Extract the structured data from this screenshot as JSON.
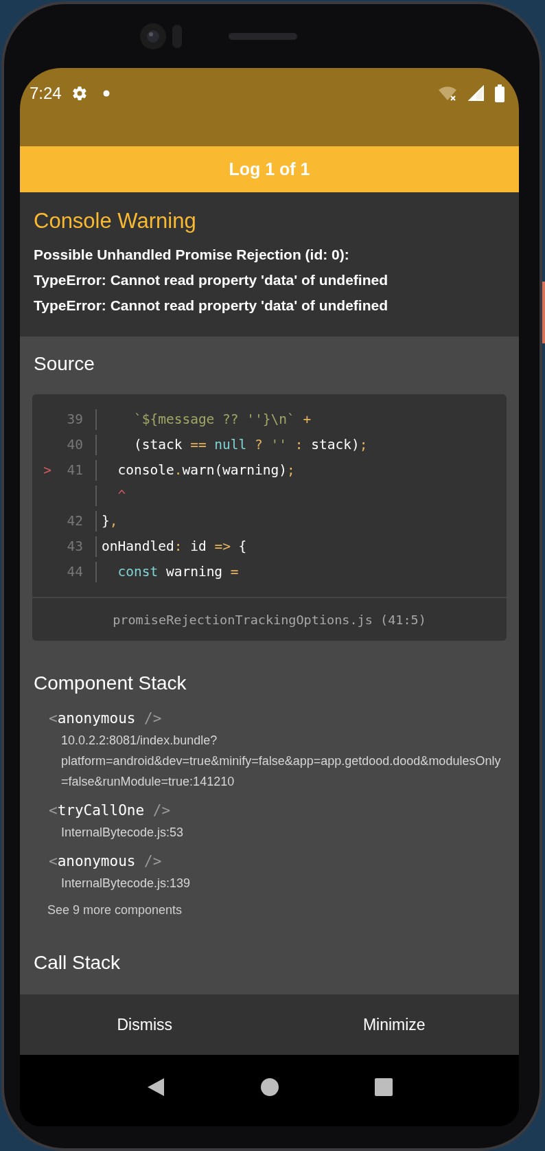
{
  "status_bar": {
    "time": "7:24"
  },
  "log_bar": {
    "title": "Log 1 of 1"
  },
  "header": {
    "title": "Console Warning",
    "message_lines": [
      "Possible Unhandled Promise Rejection (id: 0):",
      "TypeError: Cannot read property 'data' of undefined",
      "TypeError: Cannot read property 'data' of undefined"
    ]
  },
  "source": {
    "heading": "Source",
    "lines": [
      {
        "number": "39",
        "tokens": [
          {
            "text": "    `${message ?? ''}\\n`",
            "kind": "string"
          },
          {
            "text": " +",
            "kind": "punct"
          }
        ]
      },
      {
        "number": "40",
        "tokens": [
          {
            "text": "    (stack ",
            "kind": "plain"
          },
          {
            "text": "==",
            "kind": "punct"
          },
          {
            "text": " null",
            "kind": "keyword"
          },
          {
            "text": " ?",
            "kind": "punct"
          },
          {
            "text": " ''",
            "kind": "string"
          },
          {
            "text": " :",
            "kind": "punct"
          },
          {
            "text": " stack)",
            "kind": "plain"
          },
          {
            "text": ";",
            "kind": "punct"
          }
        ]
      },
      {
        "number": "41",
        "marker": ">",
        "tokens": [
          {
            "text": "  console",
            "kind": "plain"
          },
          {
            "text": ".",
            "kind": "punct"
          },
          {
            "text": "warn(warning)",
            "kind": "plain"
          },
          {
            "text": ";",
            "kind": "punct"
          }
        ]
      },
      {
        "tokens": [
          {
            "text": "  ^",
            "kind": "error"
          }
        ]
      },
      {
        "number": "42",
        "tokens": [
          {
            "text": "}",
            "kind": "plain"
          },
          {
            "text": ",",
            "kind": "punct"
          }
        ]
      },
      {
        "number": "43",
        "tokens": [
          {
            "text": "onHandled",
            "kind": "plain"
          },
          {
            "text": ":",
            "kind": "punct"
          },
          {
            "text": " id ",
            "kind": "plain"
          },
          {
            "text": "=>",
            "kind": "punct"
          },
          {
            "text": " {",
            "kind": "plain"
          }
        ]
      },
      {
        "number": "44",
        "tokens": [
          {
            "text": "  const",
            "kind": "keyword"
          },
          {
            "text": " warning ",
            "kind": "plain"
          },
          {
            "text": "=",
            "kind": "punct"
          }
        ]
      }
    ],
    "file": "promiseRejectionTrackingOptions.js (41:5)"
  },
  "component_stack": {
    "heading": "Component Stack",
    "items": [
      {
        "tag": [
          {
            "text": "<",
            "kind": "punct"
          },
          {
            "text": "anonymous",
            "kind": "name"
          },
          {
            "text": " />",
            "kind": "punct"
          }
        ],
        "location": "10.0.2.2:8081/index.bundle?platform=android&dev=true&minify=false&app=app.getdood.dood&modulesOnly=false&runModule=true:141210"
      },
      {
        "tag": [
          {
            "text": "<",
            "kind": "punct"
          },
          {
            "text": "tryCallOne",
            "kind": "name"
          },
          {
            "text": " />",
            "kind": "punct"
          }
        ],
        "location": "InternalBytecode.js:53"
      },
      {
        "tag": [
          {
            "text": "<",
            "kind": "punct"
          },
          {
            "text": "anonymous",
            "kind": "name"
          },
          {
            "text": " />",
            "kind": "punct"
          }
        ],
        "location": "InternalBytecode.js:139"
      }
    ],
    "more": "See 9 more components"
  },
  "call_stack": {
    "heading": "Call Stack"
  },
  "footer": {
    "buttons": [
      "Dismiss",
      "Minimize"
    ]
  }
}
